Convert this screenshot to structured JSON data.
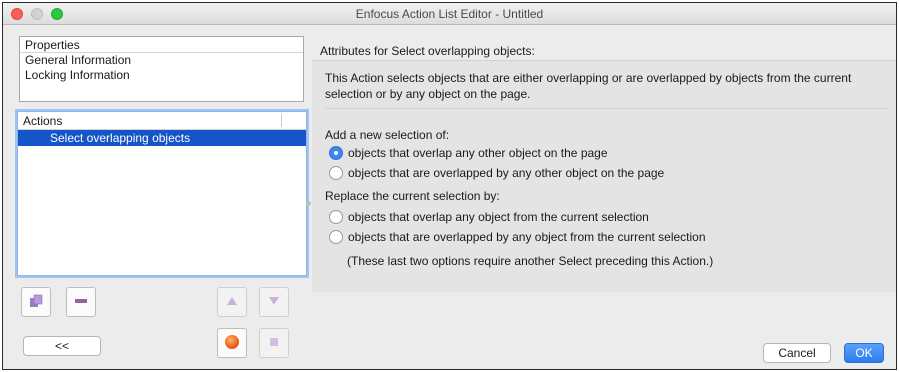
{
  "window": {
    "title": "Enfocus Action List Editor - Untitled"
  },
  "properties": {
    "header": "Properties",
    "items": [
      "General Information",
      "Locking Information"
    ]
  },
  "actions": {
    "header": "Actions",
    "items": [
      {
        "label": "Select overlapping objects",
        "selected": true
      }
    ]
  },
  "toolbar": {
    "icons": [
      "add-action-icon",
      "remove-action-icon",
      "move-up-icon",
      "move-down-icon",
      "run-icon",
      "stop-icon"
    ],
    "back_label": "<<"
  },
  "attributes": {
    "title": "Attributes for Select overlapping objects:",
    "description": "This Action selects objects that are either overlapping or are overlapped by objects from the current selection or by any object on the page.",
    "group1_label": "Add a new selection of:",
    "group1_options": [
      {
        "label": "objects that overlap any other object on the page",
        "checked": true
      },
      {
        "label": "objects that are overlapped by any other object on the page",
        "checked": false
      }
    ],
    "group2_label": "Replace the current selection by:",
    "group2_options": [
      {
        "label": "objects that overlap any object from the current selection",
        "checked": false
      },
      {
        "label": "objects that are overlapped by any object from the current selection",
        "checked": false
      }
    ],
    "note": "(These last two options require another Select preceding this Action.)"
  },
  "buttons": {
    "cancel": "Cancel",
    "ok": "OK"
  },
  "colors": {
    "selection": "#1455c8",
    "accent": "#3b86f0",
    "close": "#fc5f57",
    "maximize": "#29c940",
    "run": "#e8520f"
  }
}
